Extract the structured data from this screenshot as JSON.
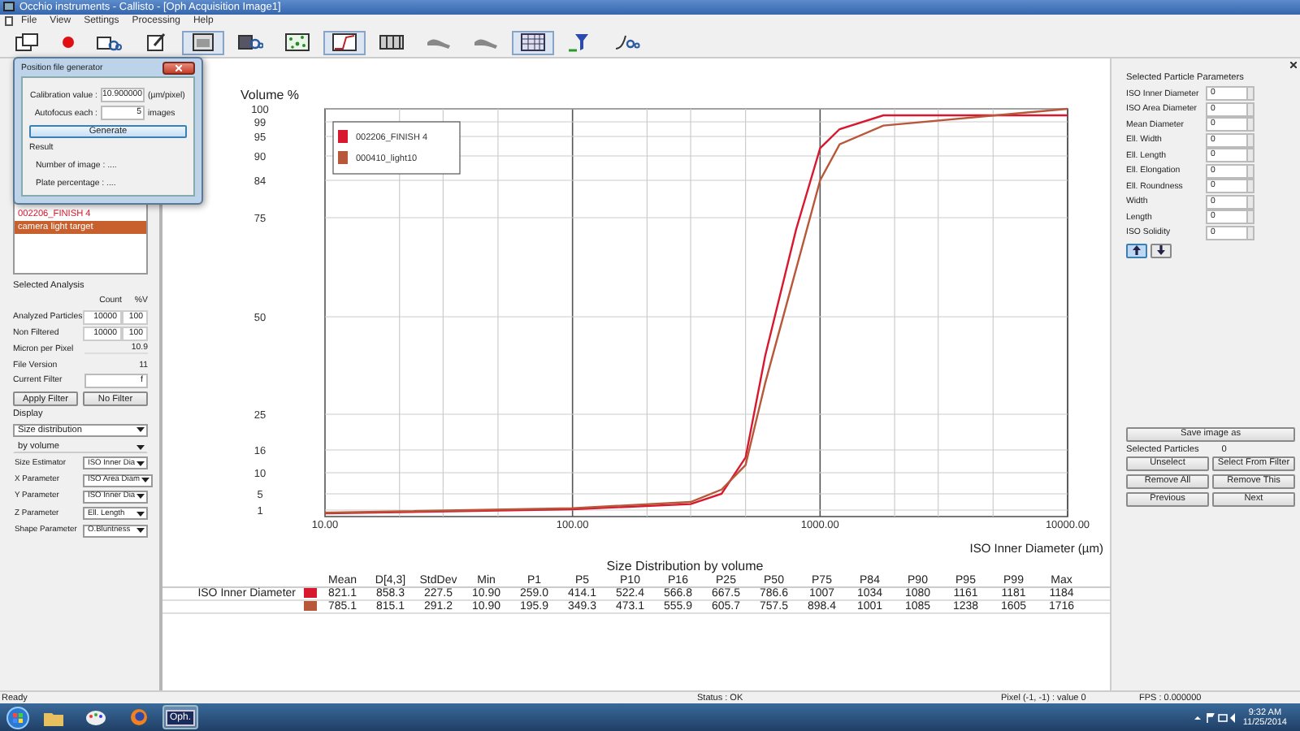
{
  "window": {
    "title": "Occhio instruments - Callisto - [Oph Acquisition Image1]"
  },
  "menu": [
    "File",
    "View",
    "Settings",
    "Processing",
    "Help"
  ],
  "toolbar": [
    {
      "kind": "windows",
      "selected": false
    },
    {
      "kind": "record",
      "selected": false
    },
    {
      "kind": "windows-gears",
      "selected": false
    },
    {
      "kind": "window-edit",
      "selected": false
    },
    {
      "kind": "window-image",
      "selected": true
    },
    {
      "kind": "gears",
      "selected": false
    },
    {
      "kind": "particles",
      "selected": false
    },
    {
      "kind": "curve",
      "selected": true
    },
    {
      "kind": "film",
      "selected": false
    },
    {
      "kind": "blob",
      "selected": false
    },
    {
      "kind": "blob",
      "selected": false
    },
    {
      "kind": "grid",
      "selected": true
    },
    {
      "kind": "filter",
      "selected": false
    },
    {
      "kind": "curve-gears",
      "selected": false
    }
  ],
  "dialog": {
    "title": "Position file generator",
    "fields": [
      {
        "label": "Calibration value :",
        "value": "10.900000",
        "unit": "(µm/pixel)"
      },
      {
        "label": "Autofocus each :",
        "value": "5",
        "unit": "images"
      }
    ],
    "button": "Generate",
    "result_label": "Result",
    "results": [
      "Number of image : ....",
      "Plate percentage : ...."
    ]
  },
  "left_panel": {
    "list": [
      {
        "label": "002206_FINISH 4",
        "selected": false
      },
      {
        "label": "camera light target",
        "selected": true
      }
    ],
    "analysis": {
      "title": "Selected Analysis",
      "columns": [
        "Count",
        "%V"
      ],
      "rows": [
        {
          "label": "Analyzed Particles",
          "values": [
            "10000",
            "100"
          ]
        },
        {
          "label": "Non Filtered",
          "values": [
            "10000",
            "100"
          ]
        }
      ]
    },
    "info": [
      {
        "label": "Micron per Pixel",
        "value": "10.9",
        "kind": "readonly"
      },
      {
        "label": "File Version",
        "value": "11",
        "kind": "text"
      },
      {
        "label": "Current Filter",
        "value": "f",
        "kind": "input"
      }
    ],
    "filter_buttons": [
      "Apply Filter",
      "No Filter"
    ],
    "display": {
      "title": "Display",
      "dropdowns": [
        "Size distribution",
        "by volume"
      ],
      "parameters": [
        {
          "label": "Size Estimator",
          "value": "ISO Inner Dia"
        },
        {
          "label": "X Parameter",
          "value": "ISO Area Diam"
        },
        {
          "label": "Y Parameter",
          "value": "ISO Inner Dia"
        },
        {
          "label": "Z Parameter",
          "value": "Ell. Length"
        },
        {
          "label": "Shape Parameter",
          "value": "O.Bluntness"
        }
      ]
    }
  },
  "chart": {
    "ylabel": "Volume %",
    "y_tick_labels": [
      "100",
      "99",
      "95",
      "90",
      "84",
      "75",
      "50",
      "25",
      "16",
      "10",
      "5",
      "1"
    ],
    "legend": [
      {
        "name": "002206_FINISH 4",
        "color": "#d8182f"
      },
      {
        "name": "000410_light10",
        "color": "#b8583a"
      }
    ],
    "x_tick_labels": [
      "10.00",
      "100.00",
      "1000.00",
      "10000.00"
    ],
    "xlabel": "ISO Inner Diameter (µm)"
  },
  "stats": {
    "title": "Size Distribution by volume",
    "columns": [
      "Mean",
      "D[4,3]",
      "StdDev",
      "Min",
      "P1",
      "P5",
      "P10",
      "P16",
      "P25",
      "P50",
      "P75",
      "P84",
      "P90",
      "P95",
      "P99",
      "Max"
    ],
    "rows": [
      {
        "label": "ISO Inner Diameter",
        "color": "#d8182f",
        "values": [
          "821.1",
          "858.3",
          "227.5",
          "10.90",
          "259.0",
          "414.1",
          "522.4",
          "566.8",
          "667.5",
          "786.6",
          "1007",
          "1034",
          "1080",
          "1161",
          "1181",
          "1184"
        ]
      },
      {
        "color": "#b8583a",
        "values": [
          "785.1",
          "815.1",
          "291.2",
          "10.90",
          "195.9",
          "349.3",
          "473.1",
          "555.9",
          "605.7",
          "757.5",
          "898.4",
          "1001",
          "1085",
          "1238",
          "1605",
          "1716"
        ]
      }
    ]
  },
  "right_panel": {
    "title": "Selected Particle Parameters",
    "params": [
      {
        "label": "ISO Inner Diameter",
        "value": "0"
      },
      {
        "label": "ISO Area Diameter",
        "value": "0"
      },
      {
        "label": "Mean Diameter",
        "value": "0"
      },
      {
        "label": "Ell. Width",
        "value": "0"
      },
      {
        "label": "Ell. Length",
        "value": "0"
      },
      {
        "label": "Ell. Elongation",
        "value": "0"
      },
      {
        "label": "Ell. Roundness",
        "value": "0"
      },
      {
        "label": "Width",
        "value": "0"
      },
      {
        "label": "Length",
        "value": "0"
      },
      {
        "label": "ISO Solidity",
        "value": "0"
      }
    ],
    "sort_buttons": [
      {
        "kind": "up",
        "selected": true
      },
      {
        "kind": "down",
        "selected": false
      }
    ],
    "save_button": "Save image as",
    "selected_particles": {
      "label": "Selected Particles",
      "value": "0"
    },
    "buttons": [
      [
        "Unselect",
        "Select From Filter"
      ],
      [
        "Remove All",
        "Remove This"
      ],
      [
        "Previous",
        "Next"
      ]
    ]
  },
  "status_bar": [
    "Ready",
    "Status : OK",
    "Pixel (-1, -1) : value 0",
    "FPS : 0.000000"
  ],
  "taskbar": {
    "apps": [
      {
        "kind": "folder",
        "selected": false
      },
      {
        "kind": "paint",
        "selected": false
      },
      {
        "kind": "browser",
        "selected": false
      },
      {
        "kind": "app",
        "label": "Oph.",
        "selected": true
      }
    ],
    "time": "9:32 AM",
    "date": "11/25/2014"
  }
}
